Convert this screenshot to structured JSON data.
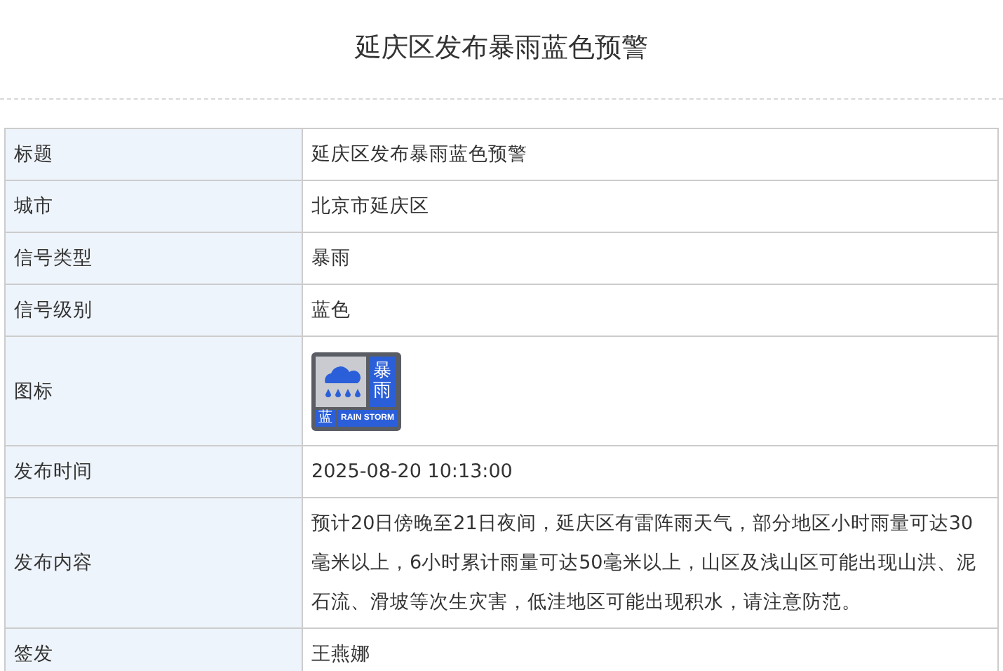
{
  "title": "延庆区发布暴雨蓝色预警",
  "rows": [
    {
      "label": "标题",
      "kind": "text",
      "value": "延庆区发布暴雨蓝色预警"
    },
    {
      "label": "城市",
      "kind": "text",
      "value": "北京市延庆区"
    },
    {
      "label": "信号类型",
      "kind": "text",
      "value": "暴雨"
    },
    {
      "label": "信号级别",
      "kind": "text",
      "value": "蓝色"
    },
    {
      "label": "图标",
      "kind": "sign",
      "sign": {
        "name": "暴雨",
        "level": "蓝",
        "caption": "RAIN STORM",
        "color": "#2b5fd9"
      }
    },
    {
      "label": "发布时间",
      "kind": "text",
      "value": "2025-08-20 10:13:00"
    },
    {
      "label": "发布内容",
      "kind": "text",
      "value": "预计20日傍晚至21日夜间，延庆区有雷阵雨天气，部分地区小时雨量可达30毫米以上，6小时累计雨量可达50毫米以上，山区及浅山区可能出现山洪、泥石流、滑坡等次生灾害，低洼地区可能出现积水，请注意防范。"
    },
    {
      "label": "签发",
      "kind": "text",
      "value": "王燕娜"
    }
  ]
}
